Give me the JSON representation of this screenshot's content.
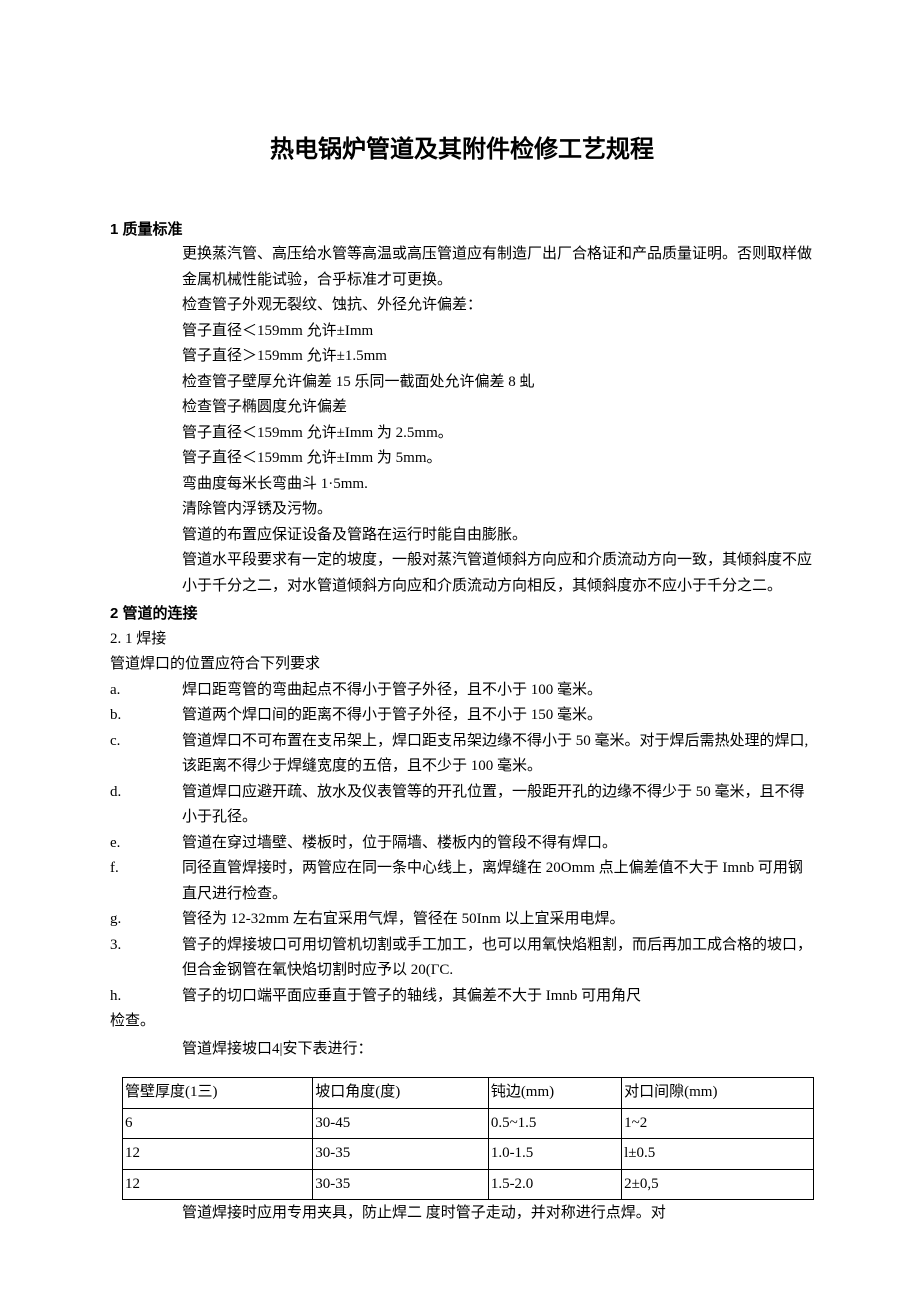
{
  "title": "热电锅炉管道及其附件检修工艺规程",
  "s1": {
    "head": "1 质量标准",
    "lines": [
      "更换蒸汽管、高压给水管等高温或高压管道应有制造厂出厂合格证和产品质量证明。否则取样做金属机械性能试验，合乎标准才可更换。",
      "检查管子外观无裂纹、蚀抗、外径允许偏差：",
      "管子直径＜159mm 允许±Imm",
      "管子直径＞159mm 允许±1.5mm",
      "检查管子壁厚允许偏差 15 乐同一截面处允许偏差 8 虬",
      "检查管子椭圆度允许偏差",
      "管子直径＜159mm 允许±Imm 为 2.5mm。",
      "管子直径＜159mm 允许±Imm 为 5mm。",
      "弯曲度每米长弯曲斗 1·5mm.",
      "清除管内浮锈及污物。",
      "管道的布置应保证设备及管路在运行时能自由膨胀。",
      "管道水平段要求有一定的坡度，一般对蒸汽管道倾斜方向应和介质流动方向一致，其倾斜度不应小于千分之二，对水管道倾斜方向应和介质流动方向相反，其倾斜度亦不应小于千分之二。"
    ]
  },
  "s2": {
    "head": "2 管道的连接",
    "sub": "2.  1 焊接",
    "intro": "管道焊口的位置应符合下列要求",
    "items": [
      {
        "label": "a.",
        "text": "焊口距弯管的弯曲起点不得小于管子外径，且不小于 100 毫米。"
      },
      {
        "label": "b.",
        "text": "管道两个焊口间的距离不得小于管子外径，且不小于 150 毫米。"
      },
      {
        "label": "c.",
        "text": "管道焊口不可布置在支吊架上，焊口距支吊架边缘不得小于 50 毫米。对于焊后需热处理的焊口,该距离不得少于焊缝宽度的五倍，且不少于 100 毫米。"
      },
      {
        "label": "d.",
        "text": "管道焊口应避开疏、放水及仪表管等的开孔位置，一般距开孔的边缘不得少于 50 毫米，且不得小于孔径。"
      },
      {
        "label": "e.",
        "text": "管道在穿过墙壁、楼板时，位于隔墙、楼板内的管段不得有焊口。"
      },
      {
        "label": "f.",
        "text": "同径直管焊接时，两管应在同一条中心线上，离焊缝在 20Omm 点上偏差值不大于 Imnb 可用钢直尺进行检查。"
      },
      {
        "label": "g.",
        "text": "管径为 12-32mm 左右宜采用气焊，管径在 50Inm 以上宜采用电焊。"
      },
      {
        "label": "3.",
        "text": "管子的焊接坡口可用切管机切割或手工加工，也可以用氧快焰粗割，而后再加工成合格的坡口，但合金钢管在氧快焰切割时应予以 20(ΓC."
      },
      {
        "label": "h.",
        "text": "管子的切口端平面应垂直于管子的轴线，其偏差不大于 Imnb 可用角尺"
      }
    ],
    "tail": "检查。"
  },
  "table": {
    "caption": "管道焊接坡口4|安下表进行：",
    "headers": [
      "管壁厚度(1三)",
      "坡口角度(度)",
      "钝边(mm)",
      "对口间隙(mm)"
    ],
    "rows": [
      [
        "6",
        "30-45",
        "0.5~1.5",
        "1~2"
      ],
      [
        "12",
        "30-35",
        "1.0-1.5",
        "l±0.5"
      ],
      [
        "12",
        "30-35",
        "1.5-2.0",
        "2±0,5"
      ]
    ]
  },
  "foot": "管道焊接时应用专用夹具，防止焊二  度时管子走动，并对称进行点焊。对"
}
